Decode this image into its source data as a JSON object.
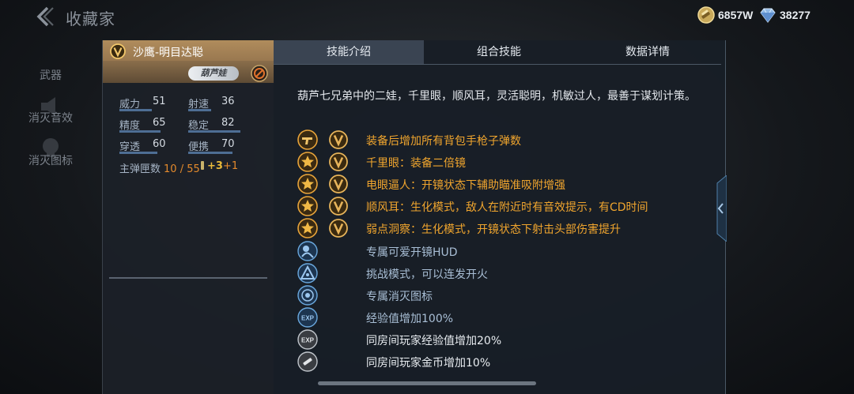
{
  "header": {
    "title": "收藏家",
    "gold_amount": "6857W",
    "diamond_amount": "38277"
  },
  "nav": {
    "weapon": "武器",
    "sound": "消灭音效",
    "kill_icon": "消灭图标"
  },
  "weapon": {
    "name": "沙鹰-明目达聪",
    "skin_tag": "葫芦娃"
  },
  "stats": {
    "power": {
      "label": "威力",
      "value": "51",
      "level": 0.51
    },
    "rate": {
      "label": "射速",
      "value": "36",
      "level": 0.36
    },
    "accuracy": {
      "label": "精度",
      "value": "65",
      "level": 0.65
    },
    "stability": {
      "label": "稳定",
      "value": "82",
      "level": 0.82
    },
    "penetration": {
      "label": "穿透",
      "value": "60",
      "level": 0.6
    },
    "portability": {
      "label": "便携",
      "value": "70",
      "level": 0.7
    },
    "ammo_label": "主弹匣数",
    "ammo_value": "10 / 55",
    "bonus_value": "+3",
    "bonus_extra": "+1"
  },
  "tabs": {
    "intro": "技能介绍",
    "combo": "组合技能",
    "data": "数据详情"
  },
  "description": "葫芦七兄弟中的二娃，千里眼，顺风耳，灵活聪明，机敏过人，最善于谋划计策。",
  "skills": [
    {
      "text": "装备后增加所有背包手枪子弹数",
      "icon": "pistol-icon",
      "badge": true,
      "style": "gold"
    },
    {
      "text": "千里眼：装备二倍镜",
      "icon": "star-icon",
      "badge": true,
      "style": "gold"
    },
    {
      "text": "电眼逼人：开镜状态下辅助瞄准吸附增强",
      "icon": "star-icon",
      "badge": true,
      "style": "gold"
    },
    {
      "text": "顺风耳：生化模式，敌人在附近时有音效提示，有CD时间",
      "icon": "star-icon",
      "badge": true,
      "style": "gold"
    },
    {
      "text": "弱点洞察：生化模式，开镜状态下射击头部伤害提升",
      "icon": "star-icon",
      "badge": true,
      "style": "gold"
    },
    {
      "text": "专属可爱开镜HUD",
      "icon": "scope-hud-icon",
      "badge": false,
      "style": "blue"
    },
    {
      "text": "挑战模式，可以连发开火",
      "icon": "challenge-icon",
      "badge": false,
      "style": "blue"
    },
    {
      "text": "专属消灭图标",
      "icon": "kill-icon",
      "badge": false,
      "style": "blue"
    },
    {
      "text": "经验值增加100%",
      "icon": "exp-icon",
      "badge": false,
      "style": "blue"
    },
    {
      "text": "同房间玩家经验值增加20%",
      "icon": "room-exp-icon",
      "badge": false,
      "style": "white"
    },
    {
      "text": "同房间玩家金币增加10%",
      "icon": "room-gold-icon",
      "badge": false,
      "style": "white"
    }
  ]
}
